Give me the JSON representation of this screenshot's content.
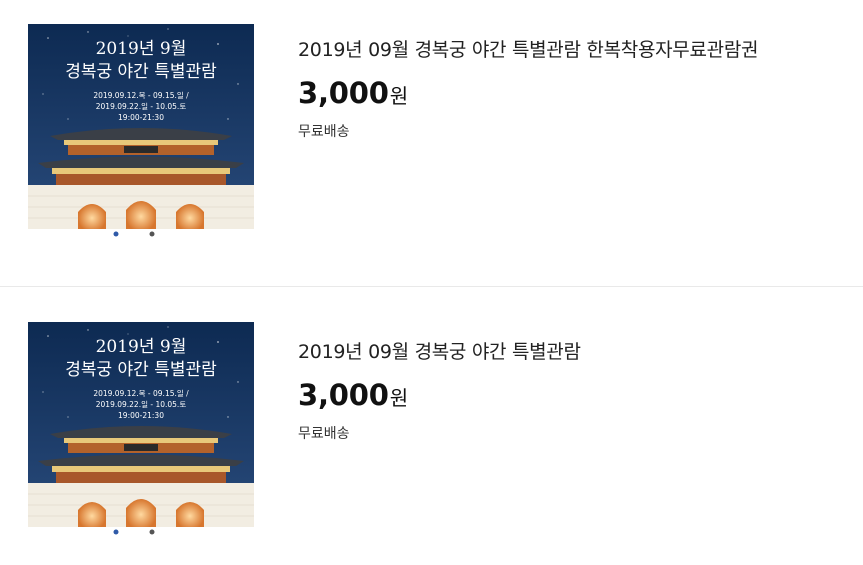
{
  "items": [
    {
      "title": "2019년 09월 경복궁 야간 특별관람 한복착용자무료관람권",
      "price": "3,000",
      "currency": "원",
      "shipping": "무료배송",
      "poster": {
        "line1": "2019년 9월",
        "line2": "경복궁 야간 특별관람",
        "date1": "2019.09.12.목 - 09.15.일 /",
        "date2": "2019.09.22.일 - 10.05.토",
        "time": "19:00-21:30"
      }
    },
    {
      "title": "2019년 09월 경복궁 야간 특별관람",
      "price": "3,000",
      "currency": "원",
      "shipping": "무료배송",
      "poster": {
        "line1": "2019년 9월",
        "line2": "경복궁 야간 특별관람",
        "date1": "2019.09.12.목 - 09.15.일 /",
        "date2": "2019.09.22.일 - 10.05.토",
        "time": "19:00-21:30"
      }
    }
  ],
  "colors": {
    "poster_sky_top": "#0d2a52",
    "poster_sky_bottom": "#27497a",
    "roof": "#3a3f47",
    "lit_eaves": "#e8c87a",
    "gate_glow": "#e08a3c",
    "wall": "#f2ede2"
  }
}
